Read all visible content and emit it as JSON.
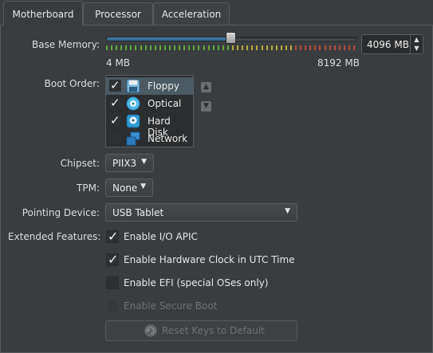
{
  "tabs": [
    {
      "label": "Motherboard",
      "active": true
    },
    {
      "label": "Processor",
      "active": false
    },
    {
      "label": "Acceleration",
      "active": false
    }
  ],
  "base_memory": {
    "label": "Base Memory:",
    "min_label": "4 MB",
    "max_label": "8192 MB",
    "value_text": "4096 MB",
    "value": 4096,
    "min": 4,
    "max": 8192
  },
  "boot_order": {
    "label": "Boot Order:",
    "items": [
      {
        "label": "Floppy",
        "checked": true,
        "selected": true,
        "icon": "floppy-icon"
      },
      {
        "label": "Optical",
        "checked": true,
        "selected": false,
        "icon": "optical-disc-icon"
      },
      {
        "label": "Hard Disk",
        "checked": true,
        "selected": false,
        "icon": "hard-disk-icon"
      },
      {
        "label": "Network",
        "checked": false,
        "selected": false,
        "icon": "network-icon"
      }
    ]
  },
  "chipset": {
    "label": "Chipset:",
    "value": "PIIX3"
  },
  "tpm": {
    "label": "TPM:",
    "value": "None"
  },
  "pointing_device": {
    "label": "Pointing Device:",
    "value": "USB Tablet"
  },
  "extended_features": {
    "label": "Extended Features:",
    "options": [
      {
        "label": "Enable I/O APIC",
        "checked": true,
        "enabled": true
      },
      {
        "label": "Enable Hardware Clock in UTC Time",
        "checked": true,
        "enabled": true
      },
      {
        "label": "Enable EFI (special OSes only)",
        "checked": false,
        "enabled": true
      },
      {
        "label": "Enable Secure Boot",
        "checked": false,
        "enabled": false
      }
    ]
  },
  "reset_button": {
    "label": "Reset Keys to Default",
    "enabled": false
  },
  "colors": {
    "background": "#3a3d40",
    "slider_fill": "#3a739c",
    "tick_green": "#5fa63a",
    "tick_yellow": "#b8a838",
    "tick_red": "#b84a3a",
    "selection": "#4b5a63"
  }
}
